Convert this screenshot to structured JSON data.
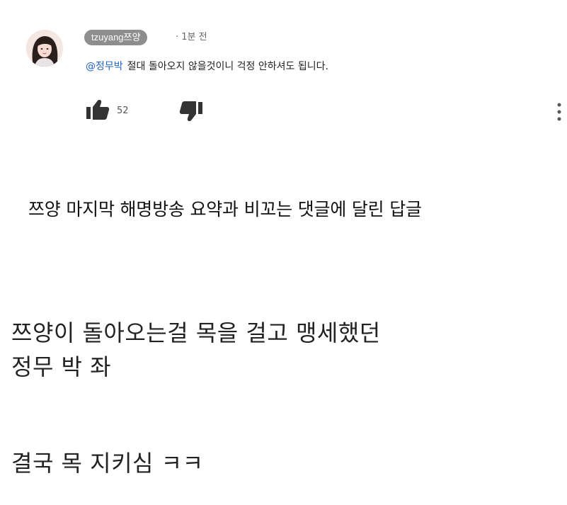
{
  "comment": {
    "author": "tzuyang쯔양",
    "time": "· 1분 전",
    "mention": "@정무박",
    "text": "절대 돌아오지 않을것이니 걱정 안하셔도 됩니다.",
    "like_count": "52",
    "icons": {
      "avatar": "avatar",
      "like": "thumbs-up-icon",
      "dislike": "thumbs-down-icon",
      "more": "more-vert-icon"
    }
  },
  "headline": "쯔양 마지막 해명방송 요약과 비꼬는 댓글에 달린 답글",
  "body": {
    "line1": "쯔양이 돌아오는걸 목을 걸고 맹세했던",
    "line2": "정무 박 좌",
    "line3": "결국 목 지키심 ㅋㅋ"
  },
  "colors": {
    "mention": "#1e63c4",
    "author_chip": "#8e8e8e",
    "icon": "#333333"
  }
}
